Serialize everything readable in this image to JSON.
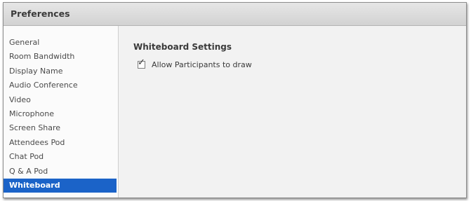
{
  "dialog": {
    "title": "Preferences"
  },
  "sidebar": {
    "items": [
      {
        "label": "General"
      },
      {
        "label": "Room Bandwidth"
      },
      {
        "label": "Display Name"
      },
      {
        "label": "Audio Conference"
      },
      {
        "label": "Video"
      },
      {
        "label": "Microphone"
      },
      {
        "label": "Screen Share"
      },
      {
        "label": "Attendees Pod"
      },
      {
        "label": "Chat Pod"
      },
      {
        "label": "Q & A Pod"
      },
      {
        "label": "Whiteboard"
      }
    ],
    "selected": "Whiteboard"
  },
  "main": {
    "section_title": "Whiteboard Settings",
    "option": {
      "label": "Allow Participants to draw",
      "checked": true,
      "check_glyph": "✓"
    }
  },
  "colors": {
    "selection": "#1b63c8"
  }
}
